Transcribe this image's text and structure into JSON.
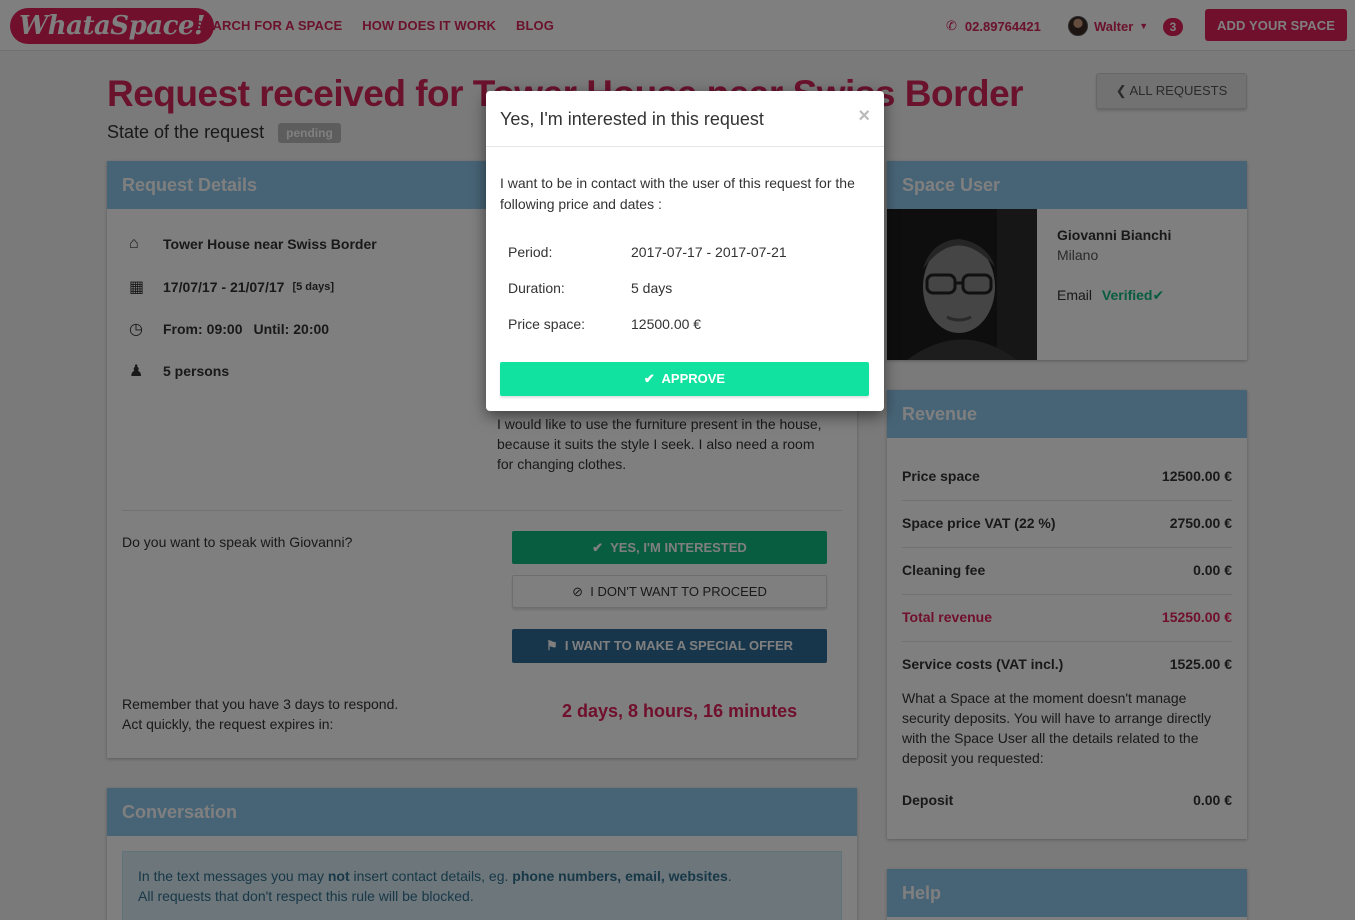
{
  "brand": {
    "logo_text": "WhataSpace!",
    "accent": "#e0215b"
  },
  "nav": {
    "links": [
      "SEARCH FOR A SPACE",
      "HOW DOES IT WORK",
      "BLOG"
    ],
    "phone": "02.89764421",
    "user_name": "Walter",
    "notifications": "3",
    "add_space": "ADD YOUR SPACE"
  },
  "page": {
    "title": "Request received for Tower House near Swiss Border",
    "state_label": "State of the request",
    "state_value": "pending",
    "all_requests": "ALL REQUESTS"
  },
  "request_details": {
    "heading": "Request Details",
    "space_name": "Tower House near Swiss Border",
    "dates": "17/07/17 - 21/07/17",
    "days_tag": "[5 days]",
    "from_label": "From:",
    "from_time": "09:00",
    "until_label": "Until:",
    "until_time": "20:00",
    "persons": "5 persons",
    "message": "I would like to use the furniture present in the house, because it suits the style I seek. I also need a room for changing clothes.",
    "question": "Do you want to speak with Giovanni?",
    "btn_yes": "YES, I'M INTERESTED",
    "btn_no": "I DON'T WANT TO PROCEED",
    "btn_offer": "I WANT TO MAKE A SPECIAL OFFER",
    "remember_1": "Remember that you have 3 days to respond.",
    "remember_2": "Act quickly, the request expires in:",
    "expires_in": "2 days, 8 hours, 16 minutes"
  },
  "conversation": {
    "heading": "Conversation",
    "note_pre": "In the text messages you may ",
    "note_not": "not",
    "note_mid": " insert contact details, eg. ",
    "note_bold": "phone numbers, email, websites",
    "note_end": ".",
    "note_line2": "All requests that don't respect this rule will be blocked."
  },
  "space_user": {
    "heading": "Space User",
    "name": "Giovanni Bianchi",
    "city": "Milano",
    "email_label": "Email",
    "verified": "Verified"
  },
  "revenue": {
    "heading": "Revenue",
    "rows": [
      {
        "label": "Price space",
        "value": "12500.00 €"
      },
      {
        "label": "Space price VAT (22 %)",
        "value": "2750.00 €"
      },
      {
        "label": "Cleaning fee",
        "value": "0.00 €"
      },
      {
        "label": "Total revenue",
        "value": "15250.00 €"
      },
      {
        "label": "Service costs (VAT incl.)",
        "value": "1525.00 €"
      }
    ],
    "note": "What a Space at the moment doesn't manage security deposits. You will have to arrange directly with the Space User all the details related to the deposit you requested:",
    "deposit_label": "Deposit",
    "deposit_value": "0.00 €"
  },
  "help": {
    "heading": "Help"
  },
  "modal": {
    "title": "Yes, I'm interested in this request",
    "close": "×",
    "intro": "I want to be in contact with the user of this request for the following price and dates :",
    "period_label": "Period:",
    "period_value": "2017-07-17 - 2017-07-21",
    "duration_label": "Duration:",
    "duration_value": "5 days",
    "price_label": "Price space:",
    "price_value": "12500.00 €",
    "approve": "APPROVE"
  }
}
